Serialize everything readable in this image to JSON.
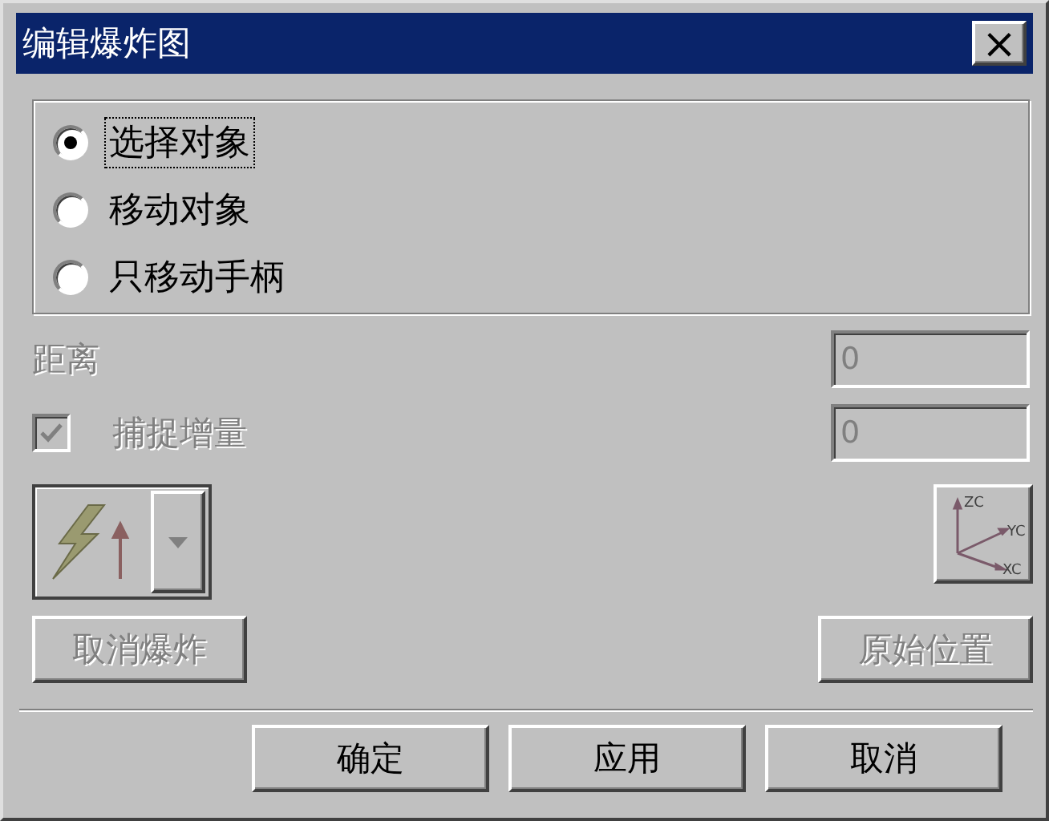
{
  "window": {
    "title": "编辑爆炸图",
    "close": "×"
  },
  "modes": [
    {
      "label": "选择对象",
      "selected": true
    },
    {
      "label": "移动对象",
      "selected": false
    },
    {
      "label": "只移动手柄",
      "selected": false
    }
  ],
  "distance": {
    "label": "距离",
    "value": "0",
    "disabled": true
  },
  "snap": {
    "label": "捕捉增量",
    "checked": true,
    "disabled": true,
    "value": "0"
  },
  "axis_labels": [
    "ZC",
    "YC",
    "XC"
  ],
  "unexplode": {
    "label": "取消爆炸",
    "disabled": true
  },
  "reset_position": {
    "label": "原始位置",
    "disabled": true
  },
  "buttons": [
    "确定",
    "应用",
    "取消"
  ]
}
